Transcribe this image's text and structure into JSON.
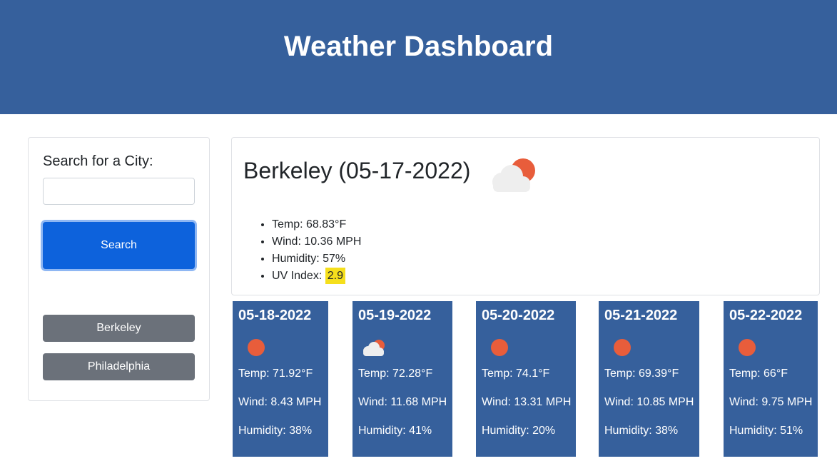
{
  "header": {
    "title": "Weather Dashboard"
  },
  "search": {
    "label": "Search for a City:",
    "input_value": "",
    "placeholder": "",
    "button_label": "Search"
  },
  "history": [
    {
      "label": "Berkeley"
    },
    {
      "label": "Philadelphia"
    }
  ],
  "current": {
    "title": "Berkeley (05-17-2022)",
    "icon": "partly-cloudy-icon",
    "temp": "Temp: 68.83°F",
    "wind": "Wind: 10.36 MPH",
    "humidity": "Humidity: 57%",
    "uv_label": "UV Index:",
    "uv_value": "2.9"
  },
  "forecast": [
    {
      "date": "05-18-2022",
      "icon": "sun-icon",
      "temp": "Temp: 71.92°F",
      "wind": "Wind: 8.43 MPH",
      "humidity": "Humidity: 38%"
    },
    {
      "date": "05-19-2022",
      "icon": "partly-cloudy-icon",
      "temp": "Temp: 72.28°F",
      "wind": "Wind: 11.68 MPH",
      "humidity": "Humidity: 41%"
    },
    {
      "date": "05-20-2022",
      "icon": "sun-icon",
      "temp": "Temp: 74.1°F",
      "wind": "Wind: 13.31 MPH",
      "humidity": "Humidity: 20%"
    },
    {
      "date": "05-21-2022",
      "icon": "sun-icon",
      "temp": "Temp: 69.39°F",
      "wind": "Wind: 10.85 MPH",
      "humidity": "Humidity: 38%"
    },
    {
      "date": "05-22-2022",
      "icon": "sun-icon",
      "temp": "Temp: 66°F",
      "wind": "Wind: 9.75 MPH",
      "humidity": "Humidity: 51%"
    }
  ],
  "colors": {
    "header_bg": "#36609c",
    "primary_button": "#0d62dc",
    "history_button": "#6b717a",
    "uv_badge": "#f5df1c",
    "sun": "#e85d3b"
  }
}
